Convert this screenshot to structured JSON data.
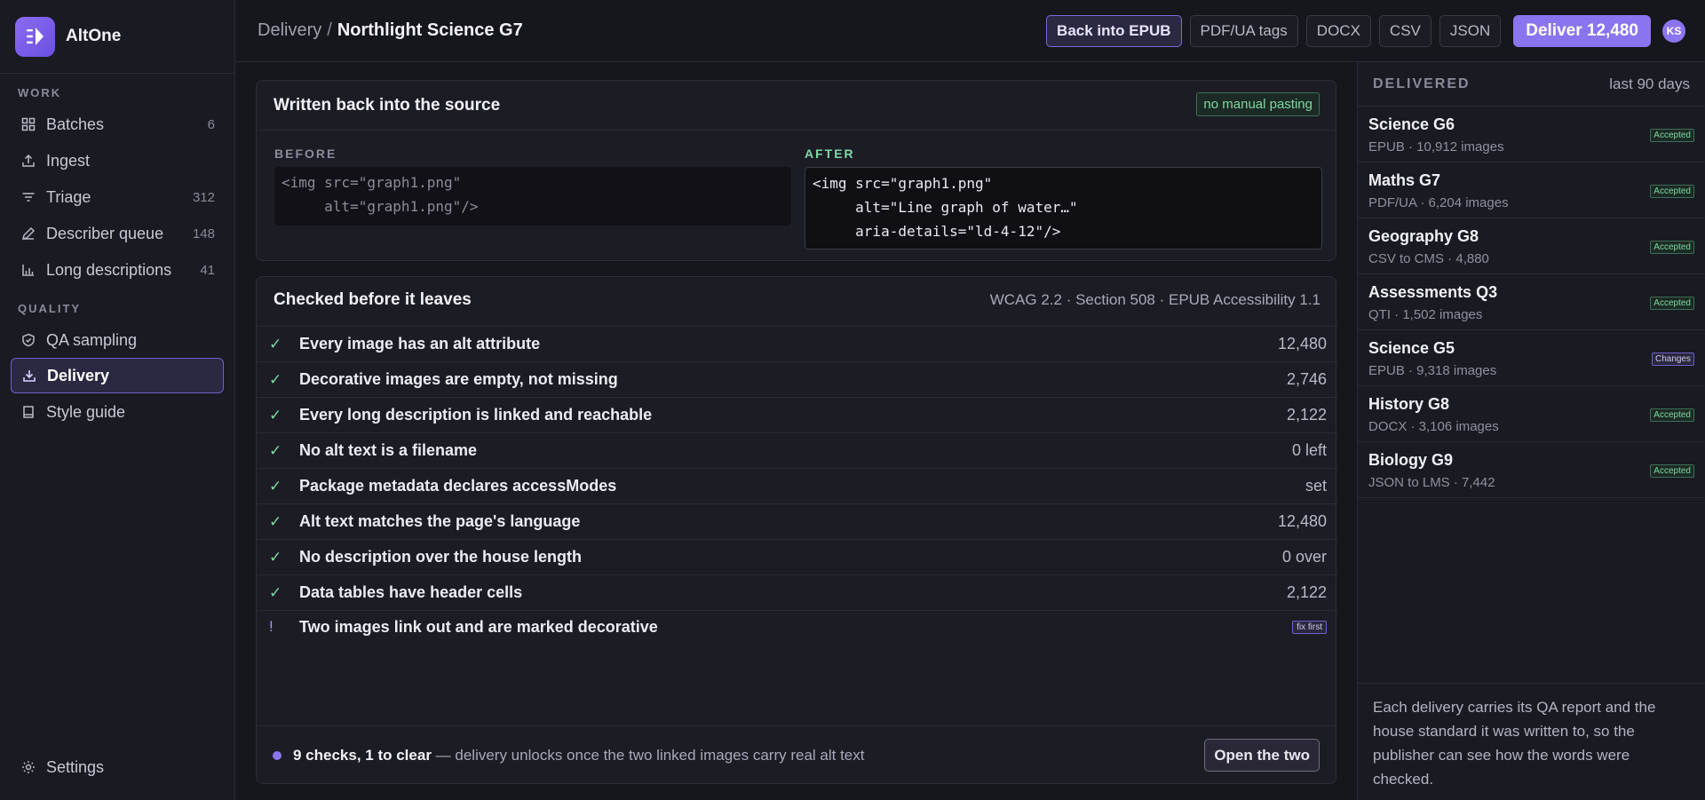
{
  "app": {
    "name": "AltOne"
  },
  "sidebar": {
    "sections": {
      "work": "WORK",
      "quality": "QUALITY"
    },
    "items": [
      {
        "label": "Batches",
        "count": "6",
        "icon": "grid-icon"
      },
      {
        "label": "Ingest",
        "count": "",
        "icon": "upload-icon"
      },
      {
        "label": "Triage",
        "count": "312",
        "icon": "filter-icon"
      },
      {
        "label": "Describer queue",
        "count": "148",
        "icon": "pencil-icon"
      },
      {
        "label": "Long descriptions",
        "count": "41",
        "icon": "bar-chart-icon"
      },
      {
        "label": "QA sampling",
        "count": "",
        "icon": "shield-check-icon"
      },
      {
        "label": "Delivery",
        "count": "",
        "icon": "download-icon",
        "active": true
      },
      {
        "label": "Style guide",
        "count": "",
        "icon": "book-icon"
      }
    ],
    "settings": "Settings"
  },
  "header": {
    "breadcrumb_root": "Delivery",
    "breadcrumb_sep": "/",
    "breadcrumb_current": "Northlight Science G7",
    "formats": [
      "Back into EPUB",
      "PDF/UA tags",
      "DOCX",
      "CSV",
      "JSON"
    ],
    "active_format": "Back into EPUB",
    "deliver_label": "Deliver 12,480",
    "avatar": "KS"
  },
  "writeback": {
    "title": "Written back into the source",
    "tag": "no manual pasting",
    "before_label": "BEFORE",
    "after_label": "AFTER",
    "before_code": "<img src=\"graph1.png\"\n     alt=\"graph1.png\"/>",
    "after_code": "<img src=\"graph1.png\"\n     alt=\"Line graph of water…\"\n     aria-details=\"ld-4-12\"/>"
  },
  "checks": {
    "title": "Checked before it leaves",
    "standards": "WCAG 2.2 · Section 508 · EPUB Accessibility 1.1",
    "rows": [
      {
        "mark": "✓",
        "label": "Every image has an alt attribute",
        "value": "12,480"
      },
      {
        "mark": "✓",
        "label": "Decorative images are empty, not missing",
        "value": "2,746"
      },
      {
        "mark": "✓",
        "label": "Every long description is linked and reachable",
        "value": "2,122"
      },
      {
        "mark": "✓",
        "label": "No alt text is a filename",
        "value": "0 left"
      },
      {
        "mark": "✓",
        "label": "Package metadata declares accessModes",
        "value": "set"
      },
      {
        "mark": "✓",
        "label": "Alt text matches the page's language",
        "value": "12,480"
      },
      {
        "mark": "✓",
        "label": "No description over the house length",
        "value": "0 over"
      },
      {
        "mark": "✓",
        "label": "Data tables have header cells",
        "value": "2,122"
      }
    ],
    "warning": {
      "mark": "!",
      "label": "Two images link out and are marked decorative",
      "tag": "fix first"
    },
    "footer_strong": "9 checks, 1 to clear",
    "footer_text": " — delivery unlocks once the two linked images carry real alt text",
    "footer_button": "Open the two"
  },
  "delivered": {
    "label": "DELIVERED",
    "range": "last 90 days",
    "items": [
      {
        "name": "Science G6",
        "meta": "EPUB · 10,912 images",
        "status": "Accepted"
      },
      {
        "name": "Maths G7",
        "meta": "PDF/UA · 6,204 images",
        "status": "Accepted"
      },
      {
        "name": "Geography G8",
        "meta": "CSV to CMS · 4,880",
        "status": "Accepted"
      },
      {
        "name": "Assessments Q3",
        "meta": "QTI · 1,502 images",
        "status": "Accepted"
      },
      {
        "name": "Science G5",
        "meta": "EPUB · 9,318 images",
        "status": "Changes"
      },
      {
        "name": "History G8",
        "meta": "DOCX · 3,106 images",
        "status": "Accepted"
      },
      {
        "name": "Biology G9",
        "meta": "JSON to LMS · 7,442",
        "status": "Accepted"
      }
    ],
    "note": "Each delivery carries its QA report and the house standard it was written to, so the publisher can see how the words were checked."
  },
  "colors": {
    "accent": "#8b74ef",
    "success": "#7fd8a4",
    "background": "#16161d"
  }
}
